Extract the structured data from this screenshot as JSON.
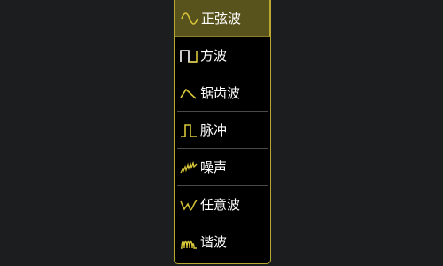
{
  "colors": {
    "accent": "#b8a832",
    "selected_bg": "#58521c",
    "background": "#1c1d1e",
    "menu_bg": "#000000",
    "text": "#ffffff"
  },
  "menu": {
    "selected_index": 0,
    "items": [
      {
        "label": "正弦波",
        "icon": "sine-wave-icon"
      },
      {
        "label": "方波",
        "icon": "square-wave-icon"
      },
      {
        "label": "锯齿波",
        "icon": "sawtooth-wave-icon"
      },
      {
        "label": "脉冲",
        "icon": "pulse-wave-icon"
      },
      {
        "label": "噪声",
        "icon": "noise-wave-icon"
      },
      {
        "label": "任意波",
        "icon": "arbitrary-wave-icon"
      },
      {
        "label": "谐波",
        "icon": "harmonic-wave-icon"
      }
    ]
  }
}
